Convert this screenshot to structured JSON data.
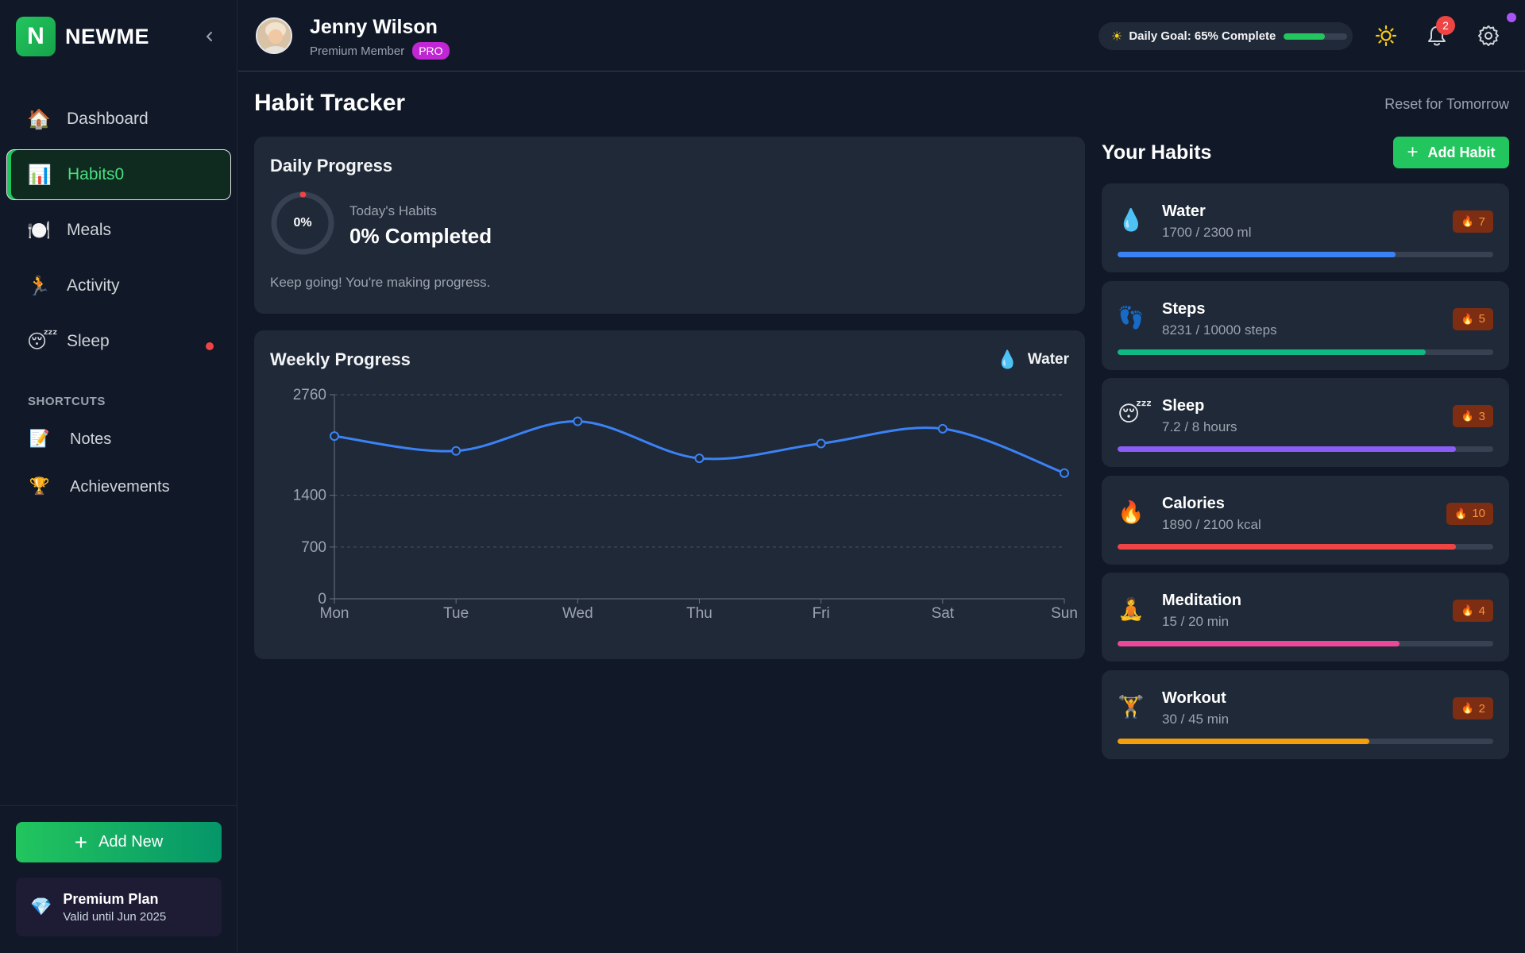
{
  "brand": {
    "logo_letter": "N",
    "name": "NEWME"
  },
  "nav": {
    "items": [
      {
        "icon": "house-icon",
        "emoji": "🏠",
        "label": "Dashboard",
        "active": false,
        "dot": false
      },
      {
        "icon": "bar-chart-icon",
        "emoji": "📊",
        "label": "Habits0",
        "active": true,
        "dot": false
      },
      {
        "icon": "plate-icon",
        "emoji": "🍽️",
        "label": "Meals",
        "active": false,
        "dot": false
      },
      {
        "icon": "runner-icon",
        "emoji": "🏃",
        "label": "Activity",
        "active": false,
        "dot": false
      },
      {
        "icon": "sleepy-face-icon",
        "emoji": "😴",
        "label": "Sleep",
        "active": false,
        "dot": true
      }
    ],
    "shortcuts_title": "SHORTCUTS",
    "shortcuts": [
      {
        "icon": "memo-icon",
        "emoji": "📝",
        "label": "Notes"
      },
      {
        "icon": "trophy-icon",
        "emoji": "🏆",
        "label": "Achievements"
      }
    ],
    "add_new_label": "Add New",
    "premium": {
      "title": "Premium Plan",
      "subtitle": "Valid until Jun 2025",
      "icon": "gem-icon"
    }
  },
  "header": {
    "user_name": "Jenny Wilson",
    "user_role": "Premium Member",
    "badge": "PRO",
    "daily_goal": "Daily Goal: 65% Complete",
    "daily_goal_progress": 0.65,
    "notifications_count": "2"
  },
  "page": {
    "title": "Habit Tracker",
    "reset_label": "Reset for Tomorrow"
  },
  "daily_progress": {
    "title": "Daily Progress",
    "ring_label": "0%",
    "progress": 0,
    "today_label": "Today's Habits",
    "completed_text": "0% Completed",
    "message": "Keep going! You're making progress."
  },
  "weekly_progress": {
    "title": "Weekly Progress",
    "legend_label": "Water"
  },
  "chart_data": {
    "type": "line",
    "x": [
      "Mon",
      "Tue",
      "Wed",
      "Thu",
      "Fri",
      "Sat",
      "Sun"
    ],
    "series": [
      {
        "name": "Water",
        "values": [
          2200,
          2000,
          2400,
          1900,
          2100,
          2300,
          1700
        ],
        "color": "#3b82f6"
      }
    ],
    "y_ticks": [
      "0",
      "700",
      "1400",
      "2760"
    ],
    "ylim": [
      0,
      2760
    ],
    "grid": true
  },
  "habits_panel": {
    "title": "Your Habits",
    "add_label": "Add Habit",
    "habits": [
      {
        "name": "Water",
        "value": "1700 / 2300 ml",
        "streak": "7",
        "emoji": "💧",
        "icon": "droplet-icon",
        "progress": 0.74,
        "color": "#3b82f6"
      },
      {
        "name": "Steps",
        "value": "8231 / 10000 steps",
        "streak": "5",
        "emoji": "👣",
        "icon": "footprints-icon",
        "progress": 0.82,
        "color": "#10b981"
      },
      {
        "name": "Sleep",
        "value": "7.2 / 8 hours",
        "streak": "3",
        "emoji": "😴",
        "icon": "sleepy-face-icon",
        "progress": 0.9,
        "color": "#8b5cf6"
      },
      {
        "name": "Calories",
        "value": "1890 / 2100 kcal",
        "streak": "10",
        "emoji": "🔥",
        "icon": "fire-icon",
        "progress": 0.9,
        "color": "#ef4444"
      },
      {
        "name": "Meditation",
        "value": "15 / 20 min",
        "streak": "4",
        "emoji": "🧘",
        "icon": "meditation-icon",
        "progress": 0.75,
        "color": "#ec4899"
      },
      {
        "name": "Workout",
        "value": "30 / 45 min",
        "streak": "2",
        "emoji": "🏋️",
        "icon": "weightlifter-icon",
        "progress": 0.67,
        "color": "#f59e0b"
      }
    ]
  }
}
